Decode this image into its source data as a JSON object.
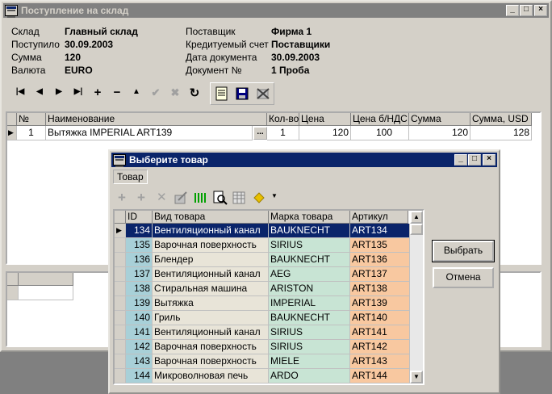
{
  "main_window": {
    "title": "Поступление на склад",
    "fields": {
      "sklad_label": "Склад",
      "sklad_value": "Главный склад",
      "date_label": "Поступило",
      "date_value": "30.09.2003",
      "sum_label": "Сумма",
      "sum_value": "120",
      "currency_label": "Валюта",
      "currency_value": "EURO",
      "supplier_label": "Поставщик",
      "supplier_value": "Фирма 1",
      "credit_label": "Кредитуемый счет",
      "credit_value": "Поставщики",
      "docdate_label": "Дата документа",
      "docdate_value": "30.09.2003",
      "docnum_label": "Документ №",
      "docnum_value": "1 Проба"
    },
    "nav_toolbar": {
      "first": "|◀",
      "prev": "◀",
      "next": "▶",
      "last": "▶|",
      "insert": "+",
      "delete": "−",
      "edit": "▲",
      "post": "✔",
      "cancel": "✖",
      "refresh": "↻"
    },
    "grid": {
      "headers": {
        "num": "№",
        "name": "Наименование",
        "qty": "Кол-во",
        "price": "Цена",
        "price_novat": "Цена б/НДС",
        "sum": "Сумма",
        "sum_usd": "Сумма, USD"
      },
      "rows": [
        {
          "num": "1",
          "name": "Вытяжка IMPERIAL ART139",
          "ellipsis": "...",
          "qty": "1",
          "price": "120",
          "price_novat": "100",
          "sum": "120",
          "sum_usd": "128"
        }
      ]
    }
  },
  "dialog": {
    "title": "Выберите товар",
    "menu_tovar": "Товар",
    "headers": {
      "id": "ID",
      "type": "Вид товара",
      "brand": "Марка товара",
      "article": "Артикул"
    },
    "rows": [
      {
        "id": "134",
        "type": "Вентиляционный канал",
        "brand": "BAUKNECHT",
        "article": "ART134"
      },
      {
        "id": "135",
        "type": "Варочная поверхность",
        "brand": "SIRIUS",
        "article": "ART135"
      },
      {
        "id": "136",
        "type": "Блендер",
        "brand": "BAUKNECHT",
        "article": "ART136"
      },
      {
        "id": "137",
        "type": "Вентиляционный канал",
        "brand": "AEG",
        "article": "ART137"
      },
      {
        "id": "138",
        "type": "Стиральная машина",
        "brand": "ARISTON",
        "article": "ART138"
      },
      {
        "id": "139",
        "type": "Вытяжка",
        "brand": "IMPERIAL",
        "article": "ART139"
      },
      {
        "id": "140",
        "type": "Гриль",
        "brand": "BAUKNECHT",
        "article": "ART140"
      },
      {
        "id": "141",
        "type": "Вентиляционный канал",
        "brand": "SIRIUS",
        "article": "ART141"
      },
      {
        "id": "142",
        "type": "Варочная поверхность",
        "brand": "SIRIUS",
        "article": "ART142"
      },
      {
        "id": "143",
        "type": "Варочная поверхность",
        "brand": "MIELE",
        "article": "ART143"
      },
      {
        "id": "144",
        "type": "Микроволновая печь",
        "brand": "ARDO",
        "article": "ART144"
      }
    ],
    "select_button": "Выбрать",
    "cancel_button": "Отмена"
  },
  "colors": {
    "id_col": "#a8d0d8",
    "type_col": "#e8e4d8",
    "brand_col": "#c8e4d4",
    "article_col": "#f8c8a0",
    "selection": "#0a246a"
  }
}
